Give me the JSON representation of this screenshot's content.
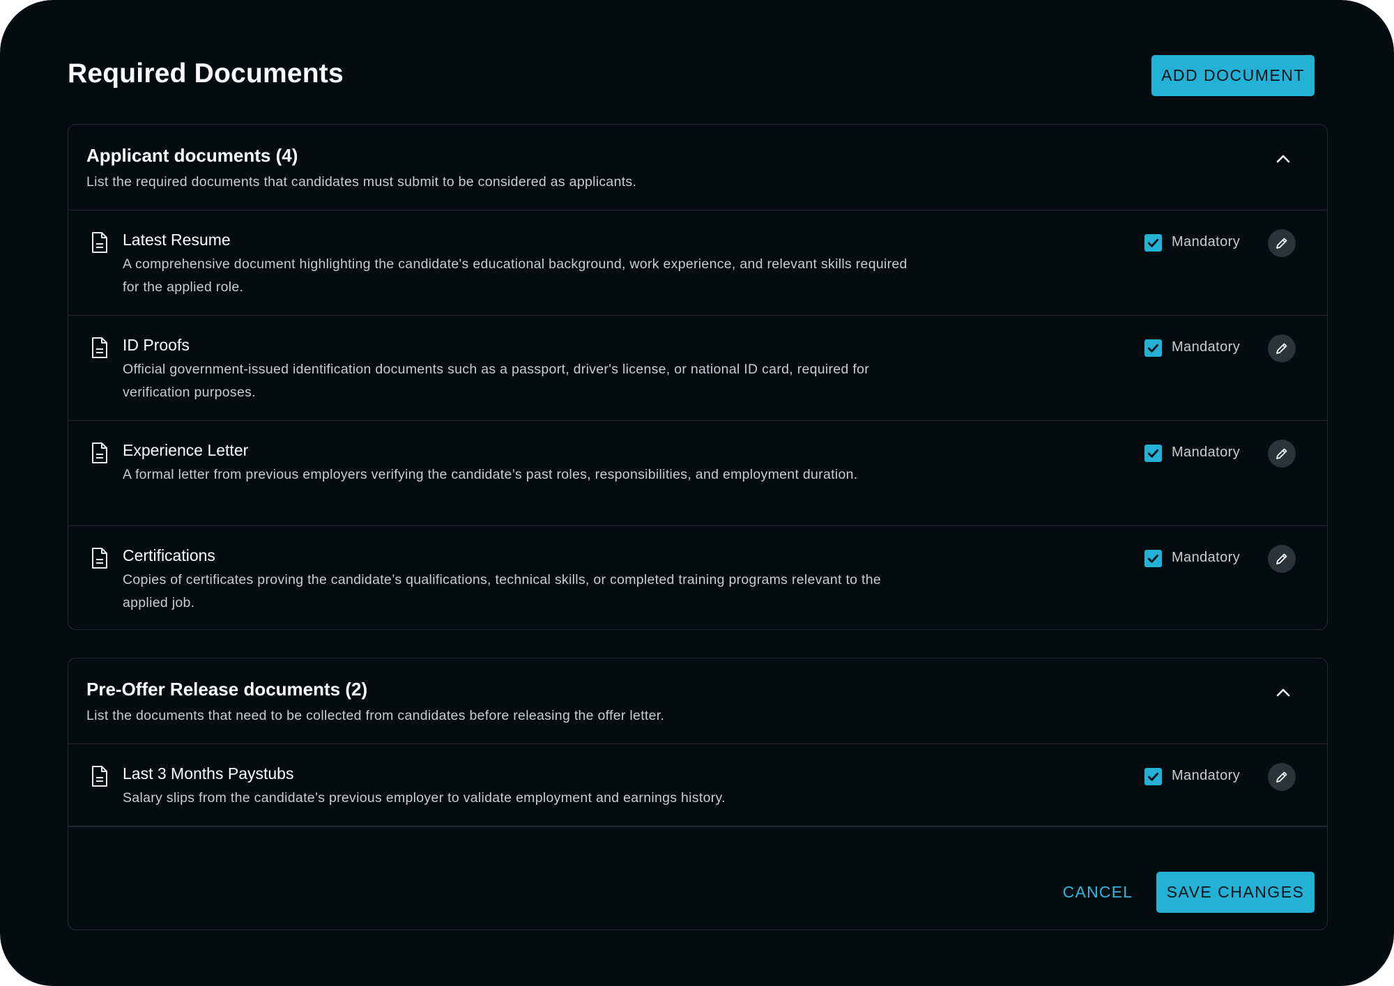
{
  "page": {
    "title": "Required Documents",
    "add_button_label": "ADD DOCUMENT"
  },
  "sections": [
    {
      "title": "Applicant documents (4)",
      "description": "List the required documents that candidates must submit to be considered as applicants.",
      "expanded": true,
      "documents": [
        {
          "title": "Latest Resume",
          "description": "A comprehensive document highlighting the candidate's educational background, work experience, and relevant skills required for the applied role.",
          "mandatory": true,
          "mandatory_label": "Mandatory"
        },
        {
          "title": "ID Proofs",
          "description": "Official government-issued identification documents such as a passport, driver's license, or national ID card, required for verification purposes.",
          "mandatory": true,
          "mandatory_label": "Mandatory"
        },
        {
          "title": "Experience Letter",
          "description": "A formal letter from previous employers verifying the candidate’s past roles, responsibilities, and employment duration.",
          "mandatory": true,
          "mandatory_label": "Mandatory"
        },
        {
          "title": "Certifications",
          "description": "Copies of certificates proving the candidate’s qualifications, technical skills, or completed training programs relevant to the applied job.",
          "mandatory": true,
          "mandatory_label": "Mandatory"
        }
      ]
    },
    {
      "title": "Pre-Offer Release documents (2)",
      "description": "List the documents that need to be collected from candidates before releasing the offer letter.",
      "expanded": true,
      "documents": [
        {
          "title": "Last 3 Months Paystubs",
          "description": "Salary slips from the candidate’s previous employer to validate employment and earnings history.",
          "mandatory": true,
          "mandatory_label": "Mandatory"
        }
      ]
    }
  ],
  "footer": {
    "cancel_label": "CANCEL",
    "save_label": "SAVE CHANGES"
  },
  "icons": {
    "document": "document-icon",
    "edit": "pencil-icon",
    "collapse": "chevron-up-icon",
    "check": "checkmark-icon"
  },
  "colors": {
    "background": "#050c10",
    "accent": "#23b1d6",
    "border": "#1f2a30",
    "text_primary": "#ffffff",
    "text_secondary": "#c6ccd0",
    "edit_button_bg": "#2c3439"
  }
}
